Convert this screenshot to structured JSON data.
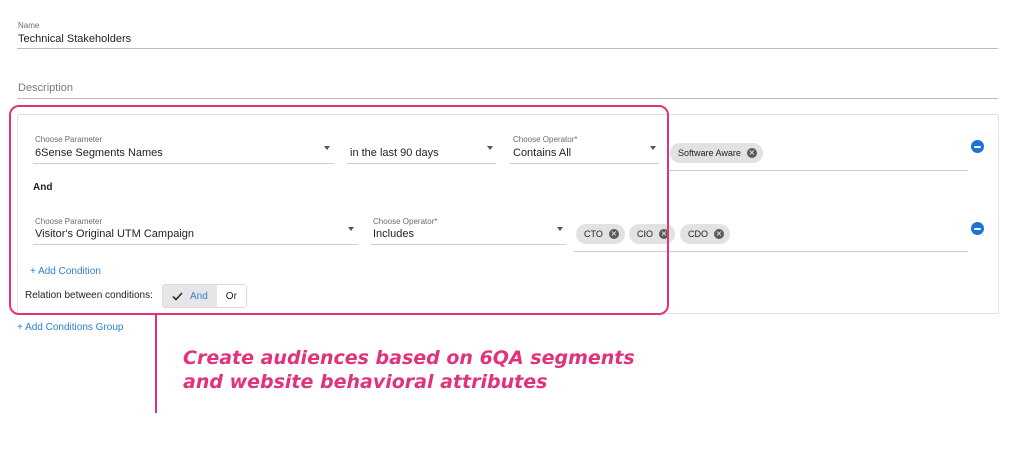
{
  "form": {
    "name_label": "Name",
    "name_value": "Technical Stakeholders",
    "description_placeholder": "Description"
  },
  "group": {
    "condition1": {
      "param_label": "Choose Parameter",
      "param_value": "6Sense Segments Names",
      "timeframe_value": "in the last 90 days",
      "operator_label": "Choose Operator*",
      "operator_value": "Contains All",
      "chips": [
        "Software Aware"
      ]
    },
    "and_label": "And",
    "condition2": {
      "param_label": "Choose Parameter",
      "param_value": "Visitor's Original UTM Campaign",
      "operator_label": "Choose Operator*",
      "operator_value": "Includes",
      "chips": [
        "CTO",
        "CIO",
        "CDO"
      ]
    },
    "add_condition": "+ Add Condition",
    "relation_label": "Relation between conditions:",
    "relation_options": [
      "And",
      "Or"
    ],
    "relation_selected": "And"
  },
  "add_group": "+ Add Conditions Group",
  "callout": {
    "line1": "Create audiences based on 6QA segments",
    "line2": "and website behavioral attributes",
    "color": "#e0337c"
  },
  "colors": {
    "accent": "#1a73d9",
    "link": "#2e7fd1",
    "highlight": "#e0337c"
  }
}
